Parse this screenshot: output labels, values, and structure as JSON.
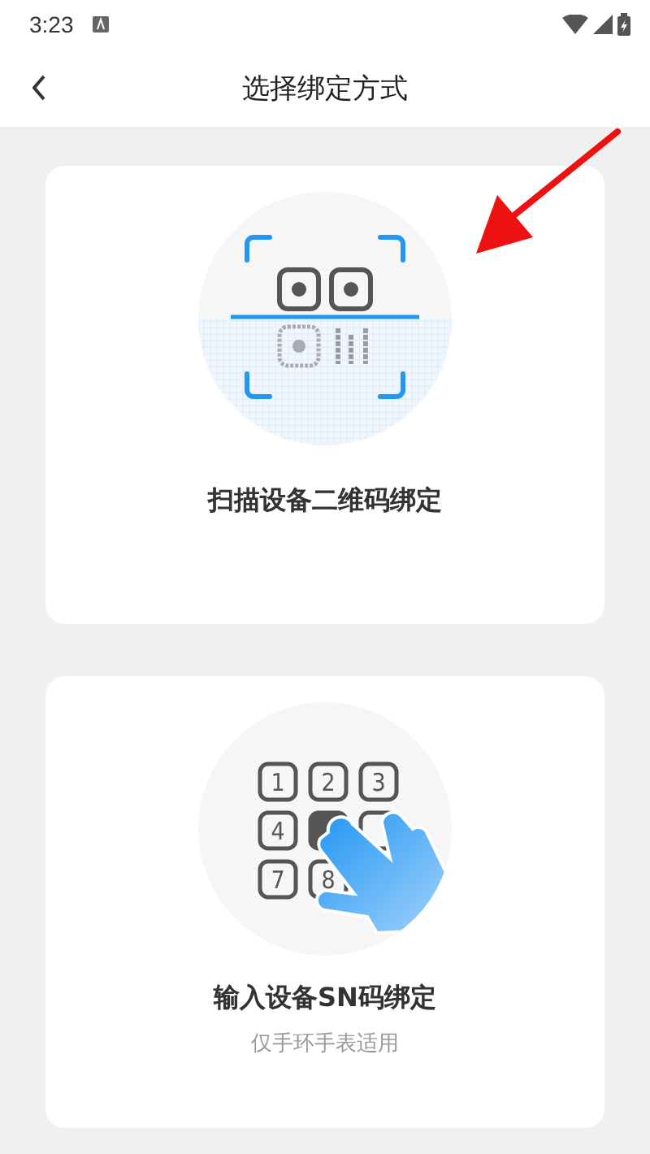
{
  "status_bar": {
    "time": "3:23"
  },
  "header": {
    "title": "选择绑定方式"
  },
  "options": [
    {
      "kind": "qr",
      "title": "扫描设备二维码绑定"
    },
    {
      "kind": "keypad",
      "title": "输入设备SN码绑定",
      "subtitle": "仅手环手表适用",
      "keys": [
        {
          "label": "1",
          "pressed": false
        },
        {
          "label": "2",
          "pressed": false
        },
        {
          "label": "3",
          "pressed": false
        },
        {
          "label": "4",
          "pressed": false
        },
        {
          "pressed": true
        },
        {
          "pressed": false
        },
        {
          "label": "7",
          "pressed": false
        },
        {
          "label": "8",
          "pressed": false
        }
      ]
    }
  ]
}
